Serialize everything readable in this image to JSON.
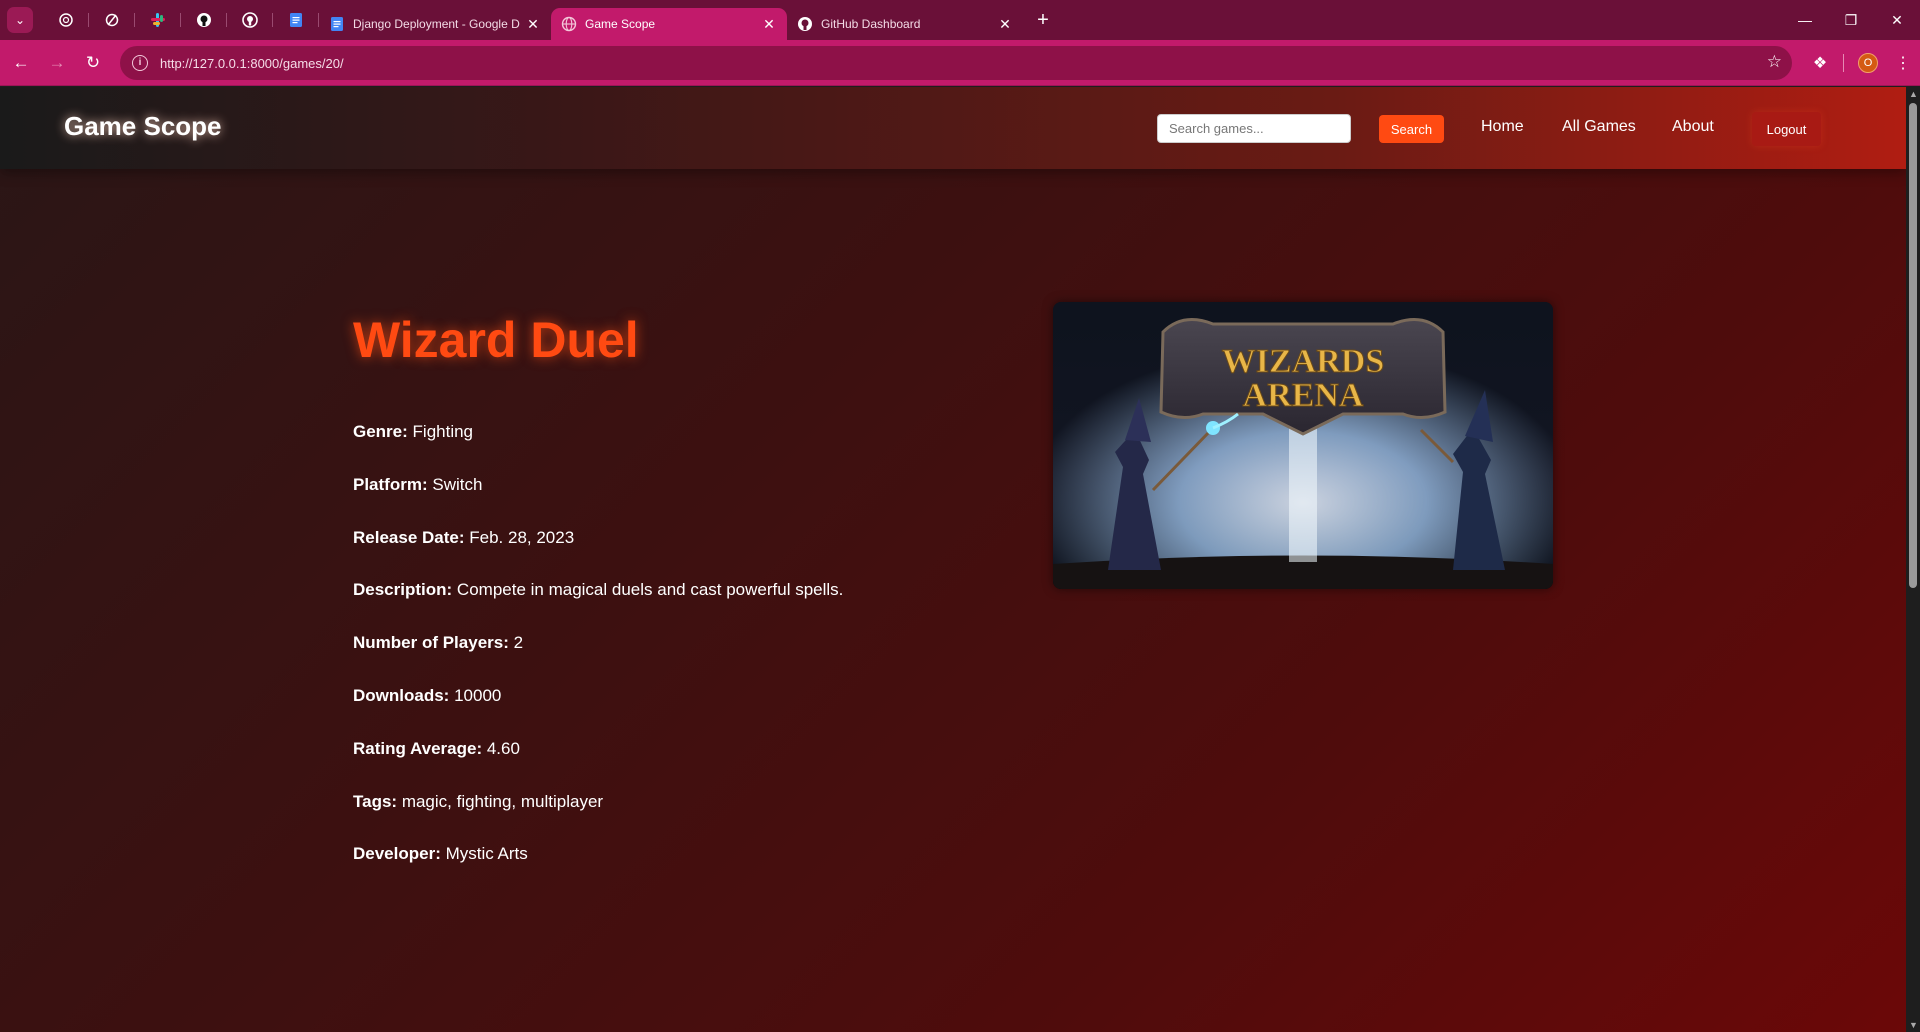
{
  "browser": {
    "tabs": [
      {
        "title": "Django Deployment - Google D",
        "icon": "google-docs-icon",
        "active": false
      },
      {
        "title": "Game Scope",
        "icon": "globe-icon",
        "active": true
      },
      {
        "title": "GitHub Dashboard",
        "icon": "github-icon",
        "active": false
      }
    ],
    "pinned_icons": [
      "chatgpt-icon",
      "perplexity-icon",
      "slack-icon",
      "github-icon",
      "github-icon",
      "google-docs-icon"
    ],
    "url": "http://127.0.0.1:8000/games/20/",
    "profile_initial": "O",
    "colors": {
      "frame": "#6a1038",
      "toolbar": "#c21a6b"
    }
  },
  "site": {
    "logo": "Game Scope",
    "search": {
      "placeholder": "Search games...",
      "button": "Search"
    },
    "nav": {
      "home": "Home",
      "all_games": "All Games",
      "about": "About",
      "logout": "Logout"
    },
    "colors": {
      "accent": "#ff4a12"
    }
  },
  "game": {
    "title": "Wizard Duel",
    "details": [
      {
        "label": "Genre:",
        "value": "Fighting"
      },
      {
        "label": "Platform:",
        "value": "Switch"
      },
      {
        "label": "Release Date:",
        "value": "Feb. 28, 2023"
      },
      {
        "label": "Description:",
        "value": "Compete in magical duels and cast powerful spells."
      },
      {
        "label": "Number of Players:",
        "value": "2"
      },
      {
        "label": "Downloads:",
        "value": "10000"
      },
      {
        "label": "Rating Average:",
        "value": "4.60"
      },
      {
        "label": "Tags:",
        "value": "magic, fighting, multiplayer"
      },
      {
        "label": "Developer:",
        "value": "Mystic Arts"
      }
    ],
    "image": {
      "banner_line1": "WIZARDS",
      "banner_line2": "ARENA"
    }
  }
}
